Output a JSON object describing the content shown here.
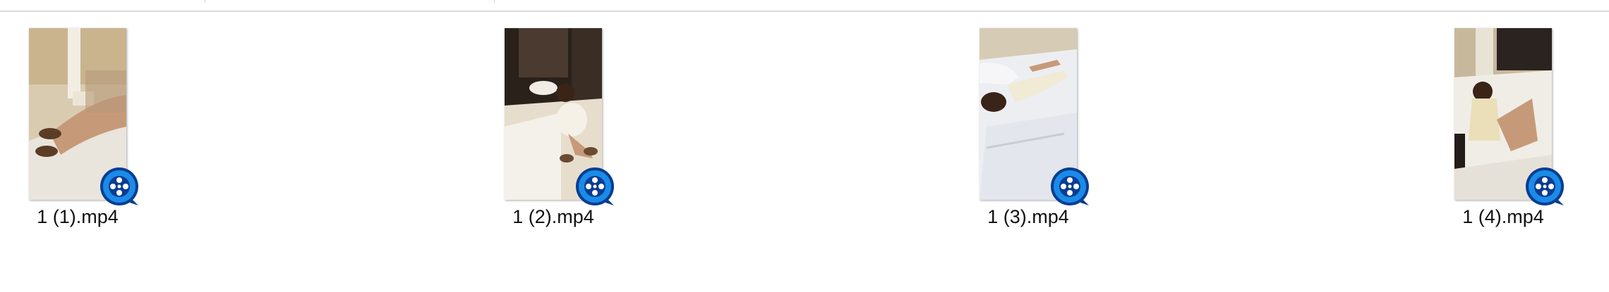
{
  "files": [
    {
      "name": "1 (1).mp4",
      "type_icon": "quicktime-player-icon",
      "thumbnail": "video-thumbnail"
    },
    {
      "name": "1 (2).mp4",
      "type_icon": "quicktime-player-icon",
      "thumbnail": "video-thumbnail"
    },
    {
      "name": "1 (3).mp4",
      "type_icon": "quicktime-player-icon",
      "thumbnail": "video-thumbnail"
    },
    {
      "name": "1 (4).mp4",
      "type_icon": "quicktime-player-icon",
      "thumbnail": "video-thumbnail"
    }
  ],
  "colors": {
    "icon_blue": "#1a8be8",
    "icon_dark": "#0b3d91",
    "label_text": "#111111",
    "header_border": "#d9d9d9"
  }
}
